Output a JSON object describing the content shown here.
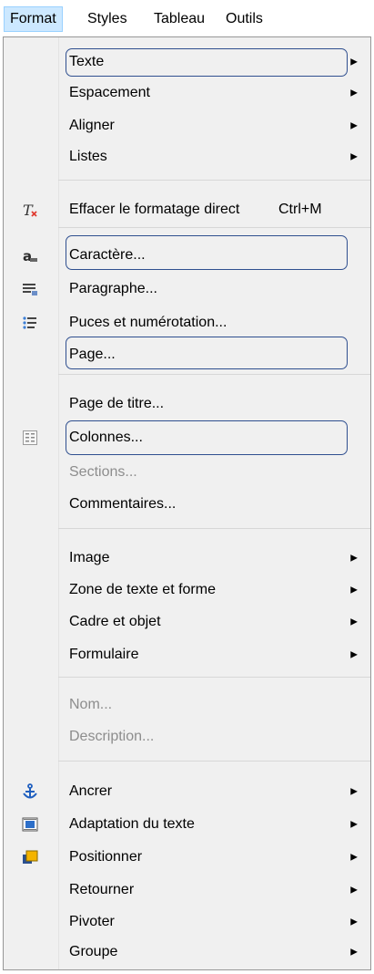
{
  "menubar": {
    "items": [
      {
        "label": "Format",
        "active": true
      },
      {
        "label": "Styles"
      },
      {
        "label": "Tableau"
      },
      {
        "label": "Outils"
      }
    ]
  },
  "menu": {
    "texte": "Texte",
    "espacement": "Espacement",
    "aligner": "Aligner",
    "listes": "Listes",
    "effacer": "Effacer le formatage direct",
    "effacer_shortcut": "Ctrl+M",
    "caractere": "Caractère...",
    "paragraphe": "Paragraphe...",
    "puces": "Puces et numérotation...",
    "page": "Page...",
    "page_titre": "Page de titre...",
    "colonnes": "Colonnes...",
    "sections": "Sections...",
    "commentaires": "Commentaires...",
    "image": "Image",
    "zone_texte": "Zone de texte et forme",
    "cadre": "Cadre et objet",
    "formulaire": "Formulaire",
    "nom": "Nom...",
    "description": "Description...",
    "ancrer": "Ancrer",
    "adaptation": "Adaptation du texte",
    "positionner": "Positionner",
    "retourner": "Retourner",
    "pivoter": "Pivoter",
    "groupe": "Groupe"
  },
  "colors": {
    "highlight_border": "#2f4f8f",
    "menu_bg": "#f0f0f0",
    "active_menubar": "#cce8ff"
  }
}
